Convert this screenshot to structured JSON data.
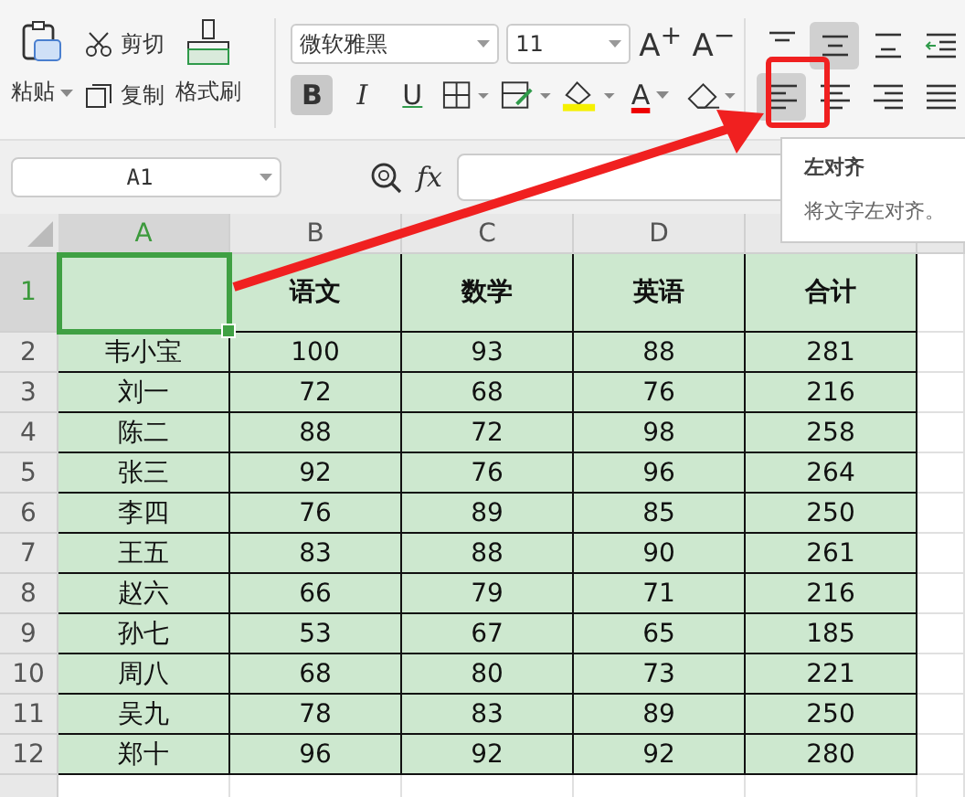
{
  "ribbon": {
    "clipboard": {
      "paste": "粘贴",
      "cut": "剪切",
      "copy": "复制",
      "format_painter": "格式刷"
    },
    "font": {
      "family": "微软雅黑",
      "size": "11",
      "grow": "A$^{+}$",
      "shrink": "A$^{−}$",
      "bold": {
        "label": "B",
        "selected": true
      },
      "italic": {
        "label": "I",
        "selected": false
      },
      "underline": {
        "label": "U",
        "selected": false
      },
      "font_color": "A"
    },
    "alignment": [
      [
        {
          "kind": "top",
          "selected": false
        },
        {
          "kind": "middle",
          "selected": true
        },
        {
          "kind": "bottom",
          "selected": false
        },
        {
          "kind": "indent",
          "selected": false
        }
      ],
      [
        {
          "kind": "left",
          "selected": true
        },
        {
          "kind": "center",
          "selected": false
        },
        {
          "kind": "right",
          "selected": false
        },
        {
          "kind": "justify",
          "selected": false
        }
      ]
    ]
  },
  "formula_bar": {
    "name_box": "A1",
    "fx": "fx"
  },
  "tooltip": {
    "title": "左对齐",
    "text": "将文字左对齐。"
  },
  "sheet": {
    "columns": [
      {
        "label": "A",
        "selected": true
      },
      {
        "label": "B",
        "selected": false
      },
      {
        "label": "C",
        "selected": false
      },
      {
        "label": "D",
        "selected": false
      }
    ],
    "header_row": {
      "number": "1",
      "selected": true,
      "cells": [
        "语文",
        "数学",
        "英语",
        "合计"
      ]
    },
    "rows": [
      {
        "number": "2",
        "cells": [
          "韦小宝",
          "100",
          "93",
          "88",
          "281"
        ]
      },
      {
        "number": "3",
        "cells": [
          "刘一",
          "72",
          "68",
          "76",
          "216"
        ]
      },
      {
        "number": "4",
        "cells": [
          "陈二",
          "88",
          "72",
          "98",
          "258"
        ]
      },
      {
        "number": "5",
        "cells": [
          "张三",
          "92",
          "76",
          "96",
          "264"
        ]
      },
      {
        "number": "6",
        "cells": [
          "李四",
          "76",
          "89",
          "85",
          "250"
        ]
      },
      {
        "number": "7",
        "cells": [
          "王五",
          "83",
          "88",
          "90",
          "261"
        ]
      },
      {
        "number": "8",
        "cells": [
          "赵六",
          "66",
          "79",
          "71",
          "216"
        ]
      },
      {
        "number": "9",
        "cells": [
          "孙七",
          "53",
          "67",
          "65",
          "185"
        ]
      },
      {
        "number": "10",
        "cells": [
          "周八",
          "68",
          "80",
          "73",
          "221"
        ]
      },
      {
        "number": "11",
        "cells": [
          "吴九",
          "78",
          "83",
          "89",
          "250"
        ]
      },
      {
        "number": "12",
        "cells": [
          "郑十",
          "96",
          "92",
          "92",
          "280"
        ]
      }
    ]
  }
}
